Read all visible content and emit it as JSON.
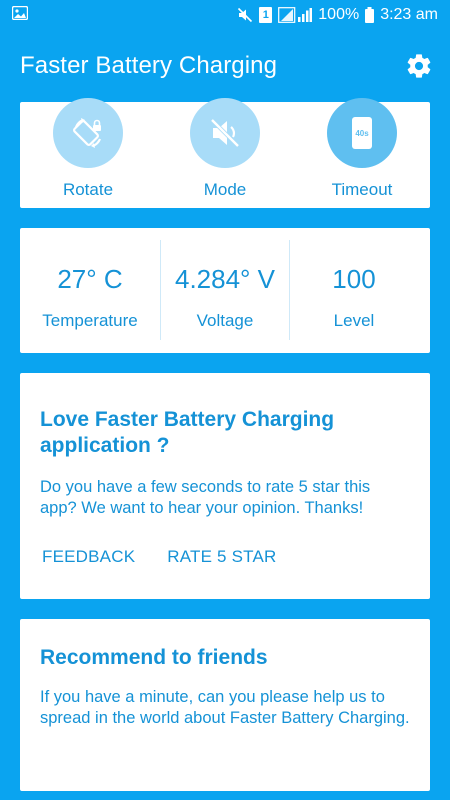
{
  "status_bar": {
    "battery_percent": "100%",
    "time": "3:23 am",
    "sim_label": "1",
    "icons": [
      "image-icon",
      "mute-icon",
      "sim-icon",
      "signal-icon",
      "battery-icon"
    ]
  },
  "app_bar": {
    "title": "Faster Battery Charging",
    "settings_icon": "gear-icon"
  },
  "actions": [
    {
      "label": "Rotate",
      "icon": "rotate-icon"
    },
    {
      "label": "Mode",
      "icon": "mute-icon"
    },
    {
      "label": "Timeout",
      "icon": "timeout-icon",
      "icon_text": "40s"
    }
  ],
  "stats": [
    {
      "value": "27° C",
      "label": "Temperature"
    },
    {
      "value": "4.284° V",
      "label": "Voltage"
    },
    {
      "value": "100",
      "label": "Level"
    }
  ],
  "rate_card": {
    "title": "Love Faster Battery Charging application ?",
    "body": "Do you have a few seconds to rate 5 star this app? We want to hear your opinion. Thanks!",
    "feedback_label": "FEEDBACK",
    "rate_label": "RATE 5 STAR"
  },
  "recommend_card": {
    "title": "Recommend to friends",
    "body": "If you have a minute, can you please help us to spread in the world about Faster Battery Charging."
  },
  "colors": {
    "primary": "#0aa4f0",
    "text_accent": "#1592d6",
    "circle_light": "#a8dcf8",
    "circle_active": "#5fbff0"
  }
}
